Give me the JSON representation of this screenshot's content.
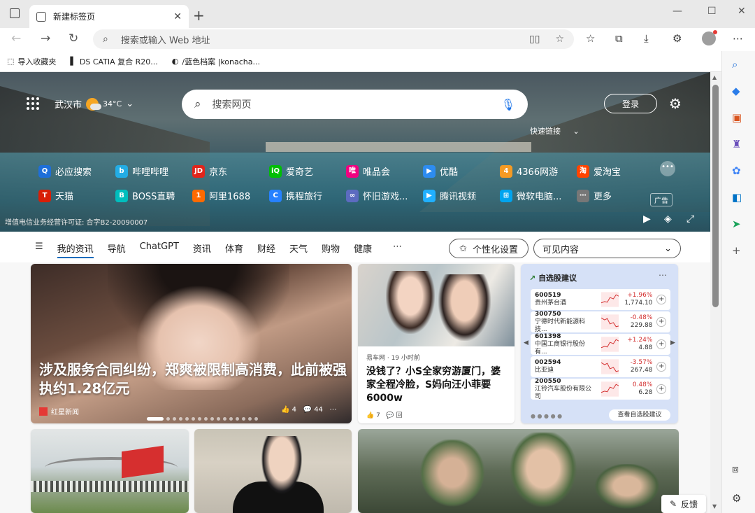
{
  "window": {
    "tab_title": "新建标签页"
  },
  "addressbar": {
    "placeholder": "搜索或输入 Web 地址"
  },
  "bookmarks": [
    {
      "label": "导入收藏夹",
      "icon": "import-icon"
    },
    {
      "label": "DS CATIA 复合 R20...",
      "icon": "ds-logo-icon"
    },
    {
      "label": "/蓝色档案 |konacha...",
      "icon": "anime-favicon-icon"
    }
  ],
  "hero": {
    "city": "武汉市",
    "temp": "34°C",
    "search_placeholder": "搜索网页",
    "login": "登录",
    "quick_links_label": "快速链接",
    "ad": "广告",
    "icp": "增值电信业务经营许可证: 合字B2-20090007"
  },
  "quick_links": [
    {
      "label": "必应搜索",
      "color": "#1e6fd9",
      "glyph": "Q"
    },
    {
      "label": "哔哩哔哩",
      "color": "#23ade5",
      "glyph": "b"
    },
    {
      "label": "京东",
      "color": "#e1251b",
      "glyph": "JD"
    },
    {
      "label": "爱奇艺",
      "color": "#00be06",
      "glyph": "iQ"
    },
    {
      "label": "唯品会",
      "color": "#f10180",
      "glyph": "唯"
    },
    {
      "label": "优酷",
      "color": "#2d8cf0",
      "glyph": "▶"
    },
    {
      "label": "4366网游",
      "color": "#f59a23",
      "glyph": "4"
    },
    {
      "label": "爱淘宝",
      "color": "#ff4400",
      "glyph": "淘"
    },
    {
      "label": "天猫",
      "color": "#d81e06",
      "glyph": "T"
    },
    {
      "label": "BOSS直聘",
      "color": "#00bebd",
      "glyph": "B"
    },
    {
      "label": "阿里1688",
      "color": "#ff6a00",
      "glyph": "1"
    },
    {
      "label": "携程旅行",
      "color": "#2681ff",
      "glyph": "C"
    },
    {
      "label": "怀旧游戏...",
      "color": "#5c6bc0",
      "glyph": "∞"
    },
    {
      "label": "腾讯视频",
      "color": "#20b0ff",
      "glyph": "▶"
    },
    {
      "label": "微软电脑...",
      "color": "#00a4ef",
      "glyph": "⊞"
    },
    {
      "label": "更多",
      "color": "#777777",
      "glyph": "⋯"
    }
  ],
  "feed_nav": [
    "我的资讯",
    "导航",
    "ChatGPT",
    "资讯",
    "体育",
    "财经",
    "天气",
    "购物",
    "健康"
  ],
  "feed_buttons": {
    "personalize": "个性化设置",
    "visible": "可见内容"
  },
  "card_main": {
    "title": "涉及服务合同纠纷，郑爽被限制高消费，此前被强执约1.28亿元",
    "source": "红星新闻",
    "likes": "4",
    "comments": "44"
  },
  "card_news": {
    "source": "易车网 · 19 小时前",
    "title": "没钱了？小S全家穷游厦门，婆家全程冷脸，S妈向汪小菲要6000w",
    "likes": "7",
    "comments": "回"
  },
  "stocks": {
    "title": "自选股建议",
    "footer": "查看自选股建议",
    "items": [
      {
        "code": "600519",
        "name": "贵州茅台酒",
        "pct": "+1.96%",
        "price": "1,774.10"
      },
      {
        "code": "300750",
        "name": "宁德时代新能源科技...",
        "pct": "-0.48%",
        "price": "229.88"
      },
      {
        "code": "601398",
        "name": "中国工商银行股份有...",
        "pct": "+1.24%",
        "price": "4.88"
      },
      {
        "code": "002594",
        "name": "比亚迪",
        "pct": "-3.57%",
        "price": "267.48"
      },
      {
        "code": "200550",
        "name": "江铃汽车股份有限公司",
        "pct": "0.48%",
        "price": "6.28"
      }
    ]
  },
  "feedback": "反馈"
}
